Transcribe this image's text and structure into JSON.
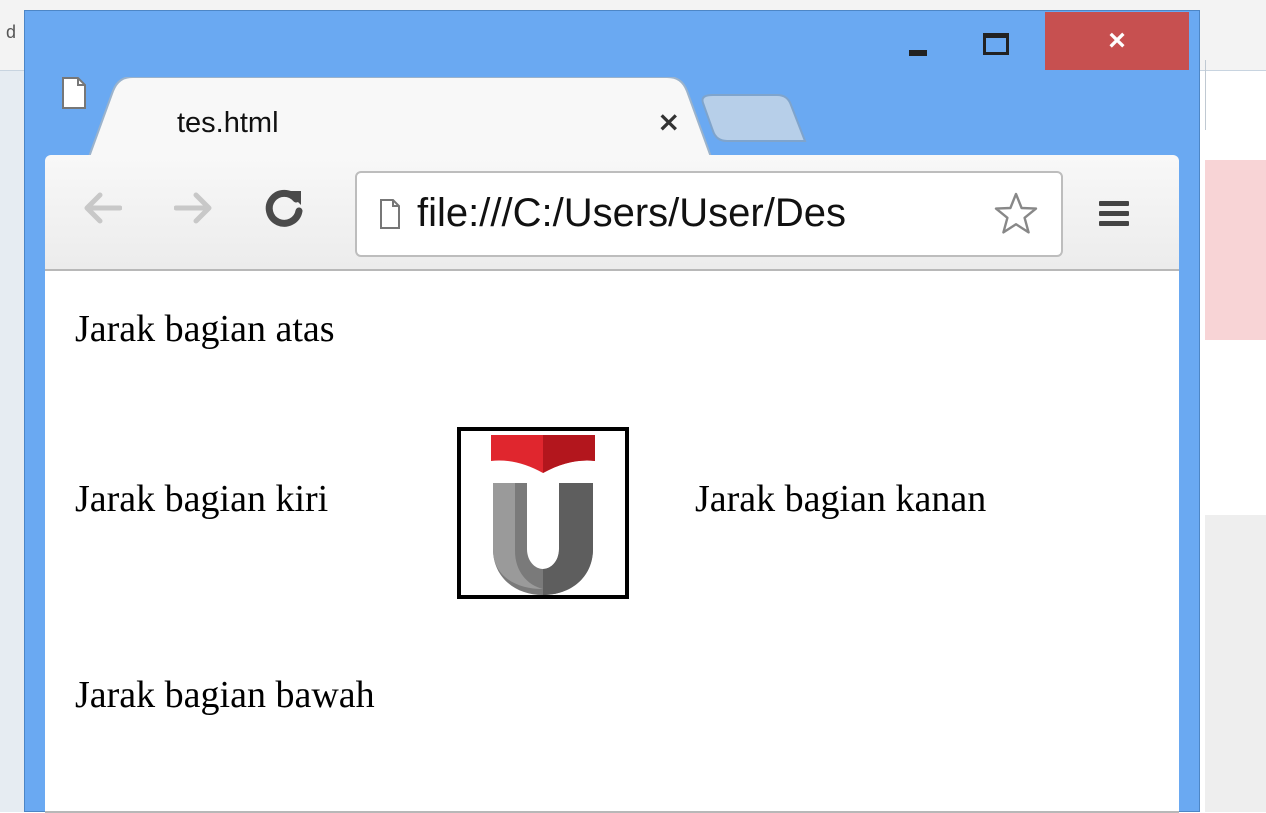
{
  "background": {
    "edge_char": "d"
  },
  "window": {
    "controls": {
      "minimize": "minimize",
      "maximize": "maximize",
      "close_label": "×"
    },
    "close_color": "#c75050",
    "frame_color": "#6aa9f2"
  },
  "tab": {
    "title": "tes.html",
    "close_label": "×"
  },
  "toolbar": {
    "url": "file:///C:/Users/User/Des"
  },
  "page": {
    "top_text": "Jarak bagian atas",
    "left_text": "Jarak bagian kiri",
    "right_text": "Jarak bagian kanan",
    "bottom_text": "Jarak bagian bawah",
    "logo": "telkom-university-logo"
  }
}
